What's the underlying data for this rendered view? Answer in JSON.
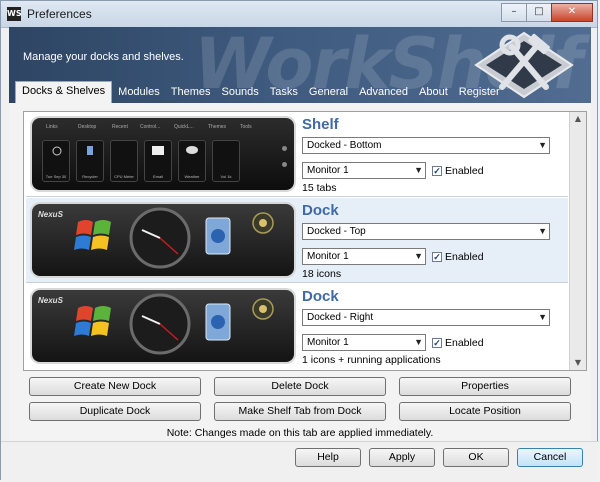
{
  "window": {
    "title": "Preferences",
    "app_icon_text": "WS",
    "buttons": [
      "–",
      "□",
      "✕"
    ]
  },
  "banner": {
    "watermark": "WorkShelf",
    "text": "Manage your docks and shelves."
  },
  "tabs": [
    {
      "label": "Docks & Shelves",
      "active": true
    },
    {
      "label": "Modules"
    },
    {
      "label": "Themes"
    },
    {
      "label": "Sounds"
    },
    {
      "label": "Tasks"
    },
    {
      "label": "General"
    },
    {
      "label": "Advanced"
    },
    {
      "label": "About"
    },
    {
      "label": "Register"
    }
  ],
  "items": [
    {
      "title": "Shelf",
      "position": "Docked - Bottom",
      "monitor": "Monitor 1",
      "enabled_label": "Enabled",
      "enabled": true,
      "count": "15 tabs",
      "preview": {
        "tabs": [
          "Links",
          "Desktop",
          "Recent",
          "Control...",
          "QuickL...",
          "Themes",
          "Tools"
        ],
        "cards": [
          "Tue Sep 30",
          "Recycler",
          "CPU Meter",
          "Email",
          "Weather",
          "Vol 1k"
        ]
      }
    },
    {
      "title": "Dock",
      "position": "Docked - Top",
      "monitor": "Monitor 1",
      "enabled_label": "Enabled",
      "enabled": true,
      "count": "18 icons",
      "preview": {
        "logo": "NexuS"
      }
    },
    {
      "title": "Dock",
      "position": "Docked - Right",
      "monitor": "Monitor 1",
      "enabled_label": "Enabled",
      "enabled": true,
      "count": "1 icons + running applications",
      "preview": {
        "logo": "NexuS"
      }
    }
  ],
  "actions": {
    "create_new_dock": "Create New Dock",
    "delete_dock": "Delete Dock",
    "properties": "Properties",
    "duplicate_dock": "Duplicate Dock",
    "make_shelf_tab": "Make Shelf Tab from Dock",
    "locate_position": "Locate Position"
  },
  "note": "Note: Changes made on this tab are applied immediately.",
  "footer": {
    "help": "Help",
    "apply": "Apply",
    "ok": "OK",
    "cancel": "Cancel"
  },
  "colors": {
    "accent_title": "#3e6aa5",
    "banner_bg": "#2e4563",
    "selected_row": "#e6eef8"
  }
}
